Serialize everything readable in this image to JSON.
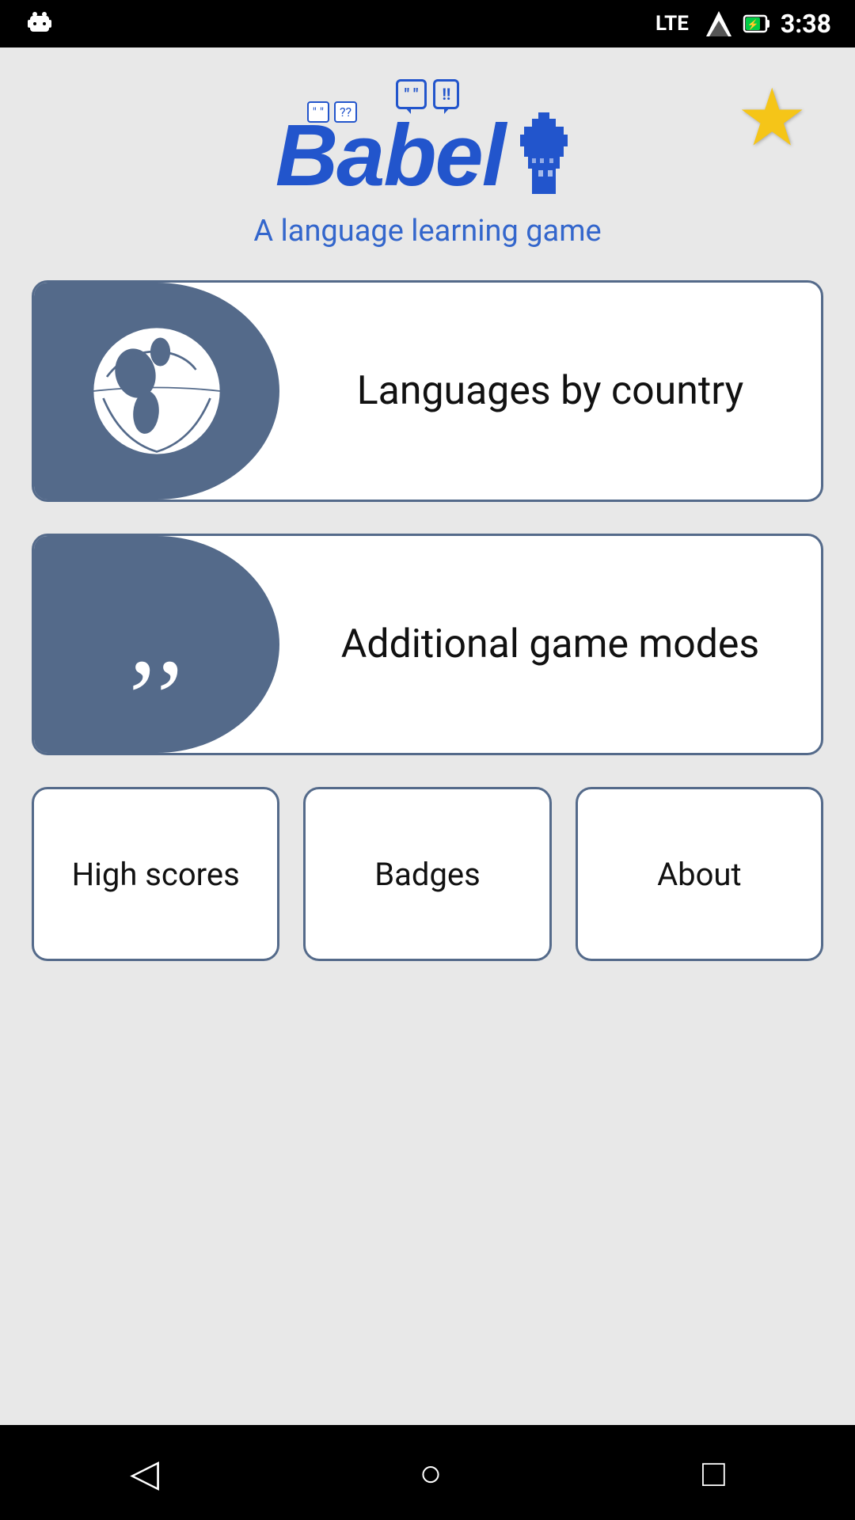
{
  "statusBar": {
    "time": "3:38",
    "lte": "LTE",
    "signal": "▲",
    "battery": "🔋"
  },
  "header": {
    "logoText": "Babel",
    "subtitle": "A language learning game",
    "starLabel": "★"
  },
  "mainButtons": [
    {
      "id": "languages-by-country",
      "label": "Languages by country",
      "icon": "globe"
    },
    {
      "id": "additional-game-modes",
      "label": "Additional game modes",
      "icon": "quote"
    }
  ],
  "bottomButtons": [
    {
      "id": "high-scores",
      "label": "High scores"
    },
    {
      "id": "badges",
      "label": "Badges"
    },
    {
      "id": "about",
      "label": "About"
    }
  ],
  "navBar": {
    "backIcon": "◁",
    "homeIcon": "○",
    "recentIcon": "□"
  },
  "colors": {
    "accent": "#546a8a",
    "blue": "#2255cc",
    "star": "#f5c518"
  }
}
